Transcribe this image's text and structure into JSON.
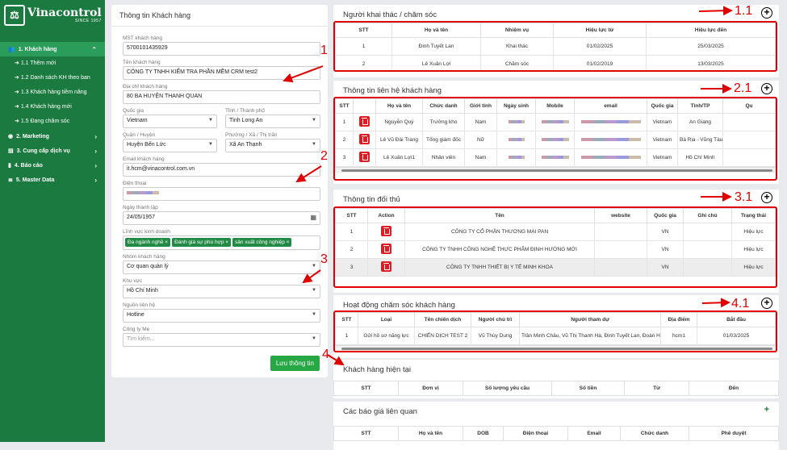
{
  "brand": {
    "name": "Vinacontrol",
    "since": "SINCE 1957"
  },
  "sidebar": [
    {
      "label": "1. Khách hàng",
      "active": true,
      "icon": "users-icon"
    },
    {
      "label": "1.1 Thêm mới",
      "sub": true
    },
    {
      "label": "1.2 Danh sách KH theo ban",
      "sub": true
    },
    {
      "label": "1.3 Khách hàng tiềm năng",
      "sub": true
    },
    {
      "label": "1.4 Khách hàng mới",
      "sub": true
    },
    {
      "label": "1.5 Đang chăm sóc",
      "sub": true
    },
    {
      "label": "2. Marketing",
      "icon": "globe-icon"
    },
    {
      "label": "3. Cung cấp dịch vụ",
      "icon": "document-icon"
    },
    {
      "label": "4. Báo cáo",
      "icon": "report-icon"
    },
    {
      "label": "5. Master Data",
      "icon": "database-icon"
    }
  ],
  "form": {
    "title": "Thông tin Khách hàng",
    "mst_label": "MST khách hàng",
    "mst": "5700101435929",
    "name_label": "Tên khách hàng",
    "name": "CÔNG TY TNHH KIỂM TRA PHẦN MỀM CRM test2",
    "address_label": "Địa chỉ khách hàng",
    "address": "80 BA HUYỆN THANH QUAN",
    "country_label": "Quốc gia",
    "country": "Vietnam",
    "province_label": "Tỉnh / Thành phố",
    "province": "Tỉnh Long An",
    "district_label": "Quận / Huyện",
    "district": "Huyện Bến Lức",
    "ward_label": "Phường / Xã / Thị trấn",
    "ward": "Xã An Thạnh",
    "email_label": "Email khách hàng",
    "email": "it.hcm@vinacontrol.com.vn",
    "phone_label": "Điện thoại",
    "date_label": "Ngày thành lập",
    "date": "24/05/1957",
    "field_label": "Lĩnh vực kinh doanh",
    "tags": [
      "Đa ngành nghề ×",
      "Đánh giá sự phù hợp ×",
      "sản xuất công nghiệp ×"
    ],
    "group_label": "Nhóm khách hàng",
    "group": "Cơ quan quản lý",
    "region_label": "Khu vực",
    "region": "Hồ Chí Minh",
    "source_label": "Nguồn liên hệ",
    "source": "Hotline",
    "parent_label": "Công ty Mẹ",
    "parent_placeholder": "Tìm kiếm...",
    "save": "Lưu thông tin"
  },
  "staff": {
    "title": "Người khai thác / chăm sóc",
    "headers": [
      "STT",
      "Họ và tên",
      "Nhiệm vụ",
      "Hiệu lực từ",
      "Hiệu lực đến"
    ],
    "rows": [
      [
        "1",
        "Đinh Tuyết Lan",
        "Khai thác",
        "01/02/2025",
        "25/03/2025"
      ],
      [
        "2",
        "Lê Xuân Lợi",
        "Chăm sóc",
        "01/02/2019",
        "13/03/2025"
      ]
    ]
  },
  "contacts": {
    "title": "Thông tin liên hệ khách hàng",
    "headers": [
      "STT",
      "",
      "Họ và tên",
      "Chức danh",
      "Giới tính",
      "Ngày sinh",
      "Mobile",
      "email",
      "Quốc gia",
      "Tỉnh/TP",
      "Qu"
    ],
    "rows": [
      [
        "1",
        "Nguyễn Quý",
        "Trưởng kho",
        "Nam",
        "Vietnam",
        "An Giang"
      ],
      [
        "2",
        "Lê Vũ Đài Trang",
        "Tổng giám đốc",
        "Nữ",
        "Vietnam",
        "Bà Rịa - Vũng Tàu"
      ],
      [
        "3",
        "Lê Xuân Lợi1",
        "Nhân viên",
        "Nam",
        "Vietnam",
        "Hồ Chí Minh"
      ]
    ]
  },
  "competitors": {
    "title": "Thông tin đối thủ",
    "headers": [
      "STT",
      "Action",
      "Tên",
      "website",
      "Quốc gia",
      "Ghi chú",
      "Trạng thái"
    ],
    "rows": [
      [
        "1",
        "CÔNG TY CỔ PHẦN THƯƠNG MẠI PAN",
        "VN",
        "Hiệu lực"
      ],
      [
        "2",
        "CÔNG TY TNHH CÔNG NGHỆ THỰC PHẨM ĐỊNH HƯỚNG MỚI",
        "VN",
        "Hiệu lực"
      ],
      [
        "3",
        "CÔNG TY TNHH THIẾT BỊ Y TẾ MINH KHOA",
        "VN",
        "Hiệu lực"
      ]
    ]
  },
  "activities": {
    "title": "Hoạt động chăm sóc khách hàng",
    "headers": [
      "STT",
      "Loại",
      "Tên chiến dịch",
      "Người chủ trì",
      "Người tham dự",
      "Địa điểm",
      "Bắt đầu"
    ],
    "rows": [
      [
        "1",
        "Gửi hồ sơ năng lực",
        "CHIẾN DỊCH TEST 2",
        "Vũ Thùy Dung",
        "Trần Minh Châu, Vũ Thị Thanh Hà, Đinh Tuyết Lan, Đoàn Hải Nguyên",
        "hcm1",
        "01/03/2025"
      ]
    ]
  },
  "current": {
    "title": "Khách hàng hiện tại",
    "headers": [
      "STT",
      "Đơn vị",
      "Số lượng yêu cầu",
      "Số tiền",
      "Từ",
      "Đến"
    ]
  },
  "quotes": {
    "title": "Các báo giá liên quan",
    "headers": [
      "STT",
      "Họ và tên",
      "DOB",
      "Điện thoại",
      "Email",
      "Chức danh",
      "Phê duyệt"
    ]
  },
  "annotations": [
    "1.1",
    "1",
    "2.1",
    "2",
    "3.1",
    "3",
    "4.1",
    "4"
  ],
  "colors": {
    "brand": "#1b7a3f",
    "annotation": "#e10000",
    "delete": "#e01b24"
  }
}
